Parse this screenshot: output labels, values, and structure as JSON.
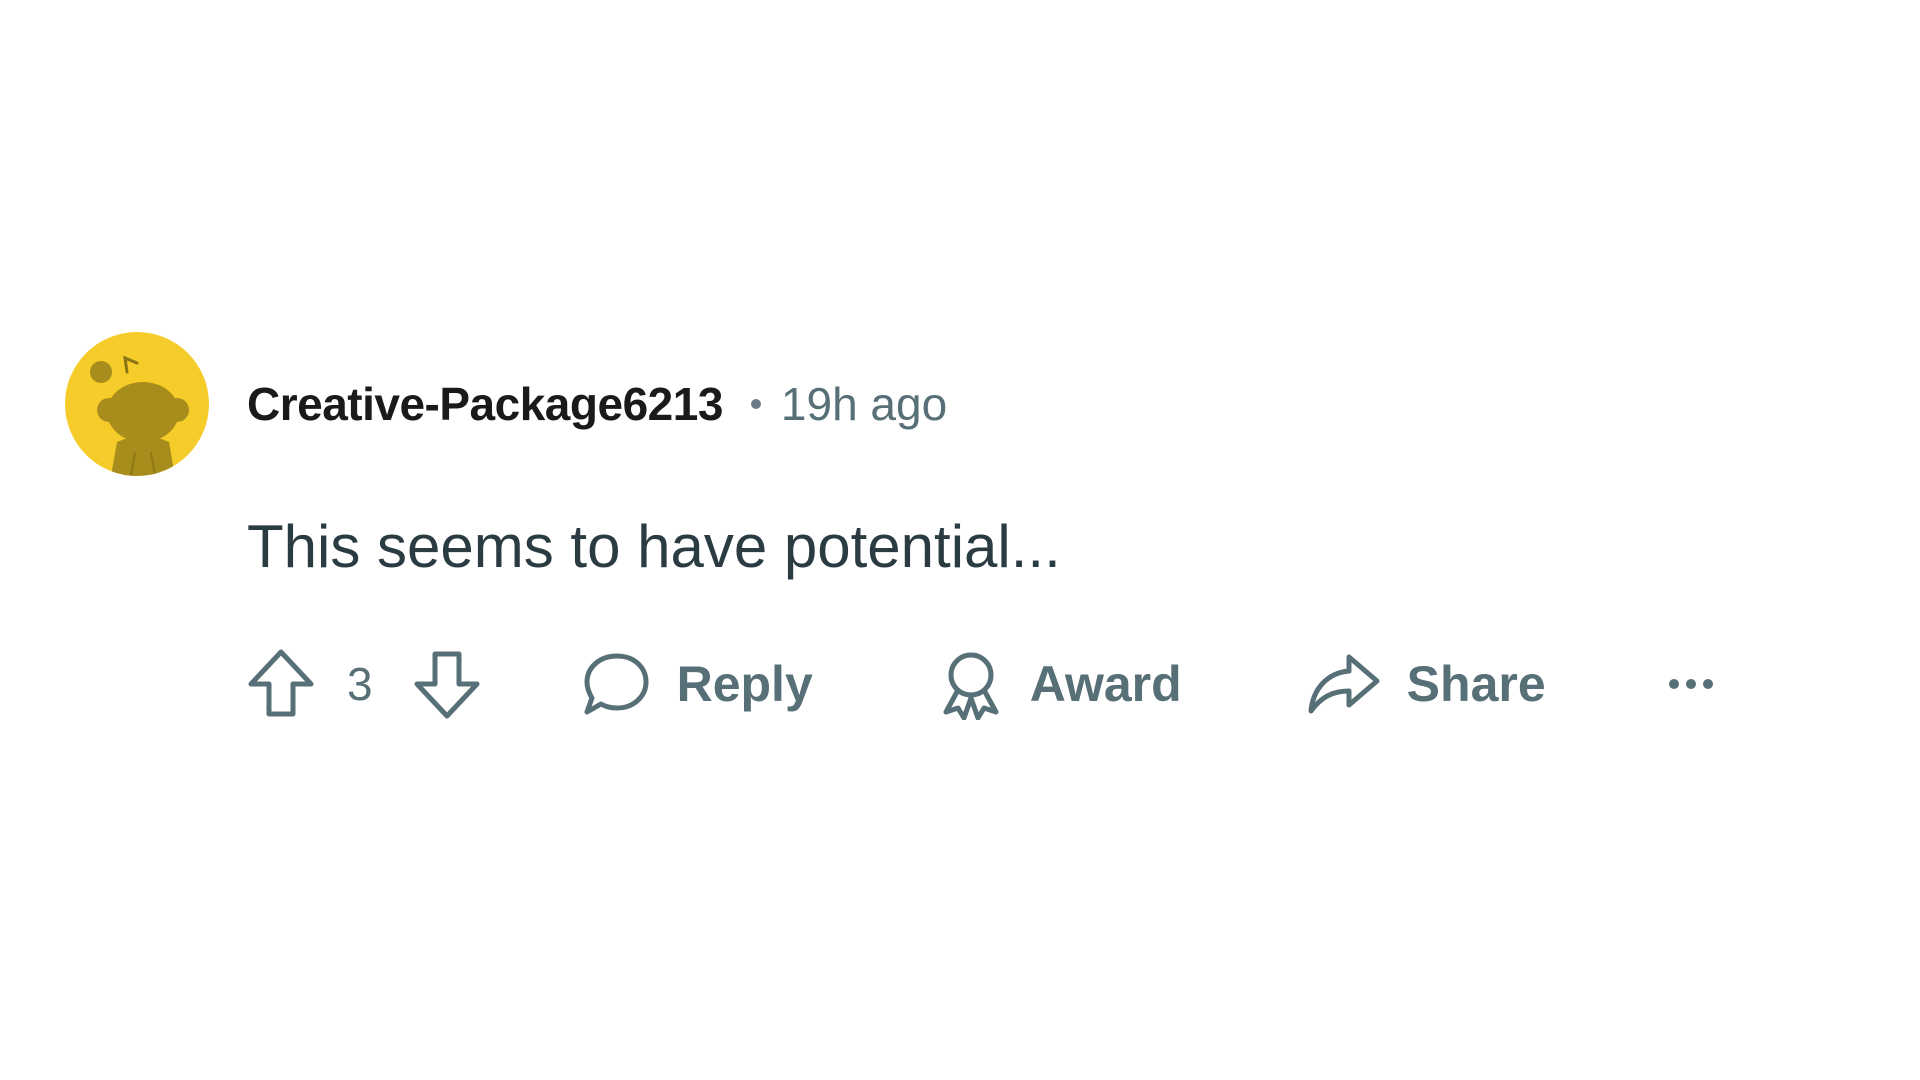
{
  "comment": {
    "author": "Creative-Package6213",
    "timestamp": "19h ago",
    "text": "This seems to have potential...",
    "avatar_color": "#f5cc2a",
    "avatar_icon": "snoo-avatar-icon"
  },
  "actions": {
    "upvote_icon": "upvote-arrow-icon",
    "vote_count": "3",
    "downvote_icon": "downvote-arrow-icon",
    "reply_label": "Reply",
    "award_label": "Award",
    "share_label": "Share",
    "more_icon": "ellipsis-icon"
  },
  "colors": {
    "text_muted": "#576f76",
    "text_primary": "#1a1a1b"
  }
}
